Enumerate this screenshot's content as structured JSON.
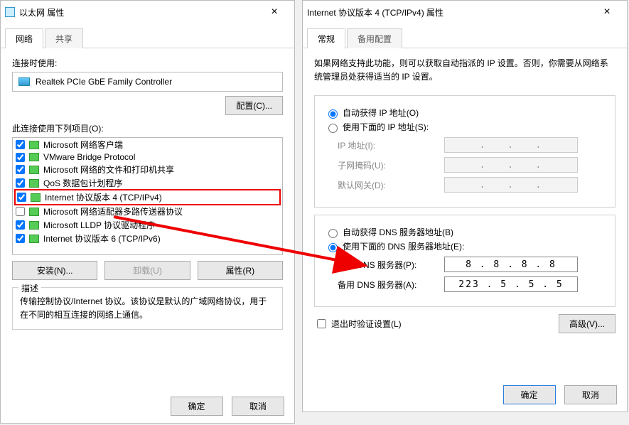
{
  "left": {
    "title": "以太网 属性",
    "tabs": [
      "网络",
      "共享"
    ],
    "connect_label": "连接时使用:",
    "adapter": "Realtek PCIe GbE Family Controller",
    "configure_btn": "配置(C)...",
    "uses_label": "此连接使用下列项目(O):",
    "items": [
      "Microsoft 网络客户端",
      "VMware Bridge Protocol",
      "Microsoft 网络的文件和打印机共享",
      "QoS 数据包计划程序",
      "Internet 协议版本 4 (TCP/IPv4)",
      "Microsoft 网络适配器多路传送器协议",
      "Microsoft LLDP 协议驱动程序",
      "Internet 协议版本 6 (TCP/IPv6)"
    ],
    "install_btn": "安装(N)...",
    "uninstall_btn": "卸载(U)",
    "properties_btn": "属性(R)",
    "desc_legend": "描述",
    "desc_text": "传输控制协议/Internet 协议。该协议是默认的广域网络协议，用于在不同的相互连接的网络上通信。",
    "ok": "确定",
    "cancel": "取消"
  },
  "right": {
    "title": "Internet 协议版本 4 (TCP/IPv4) 属性",
    "tabs": [
      "常规",
      "备用配置"
    ],
    "intro": "如果网络支持此功能，则可以获取自动指派的 IP 设置。否则，你需要从网络系统管理员处获得适当的 IP 设置。",
    "auto_ip": "自动获得 IP 地址(O)",
    "manual_ip": "使用下面的 IP 地址(S):",
    "ip_label": "IP 地址(I):",
    "mask_label": "子网掩码(U):",
    "gw_label": "默认网关(D):",
    "auto_dns": "自动获得 DNS 服务器地址(B)",
    "manual_dns": "使用下面的 DNS 服务器地址(E):",
    "dns1_label": "首选 DNS 服务器(P):",
    "dns2_label": "备用 DNS 服务器(A):",
    "dns1_value": "8 . 8 . 8 . 8",
    "dns2_value": "223 . 5 . 5 . 5",
    "validate": "退出时验证设置(L)",
    "advanced": "高级(V)...",
    "ok": "确定",
    "cancel": "取消"
  }
}
